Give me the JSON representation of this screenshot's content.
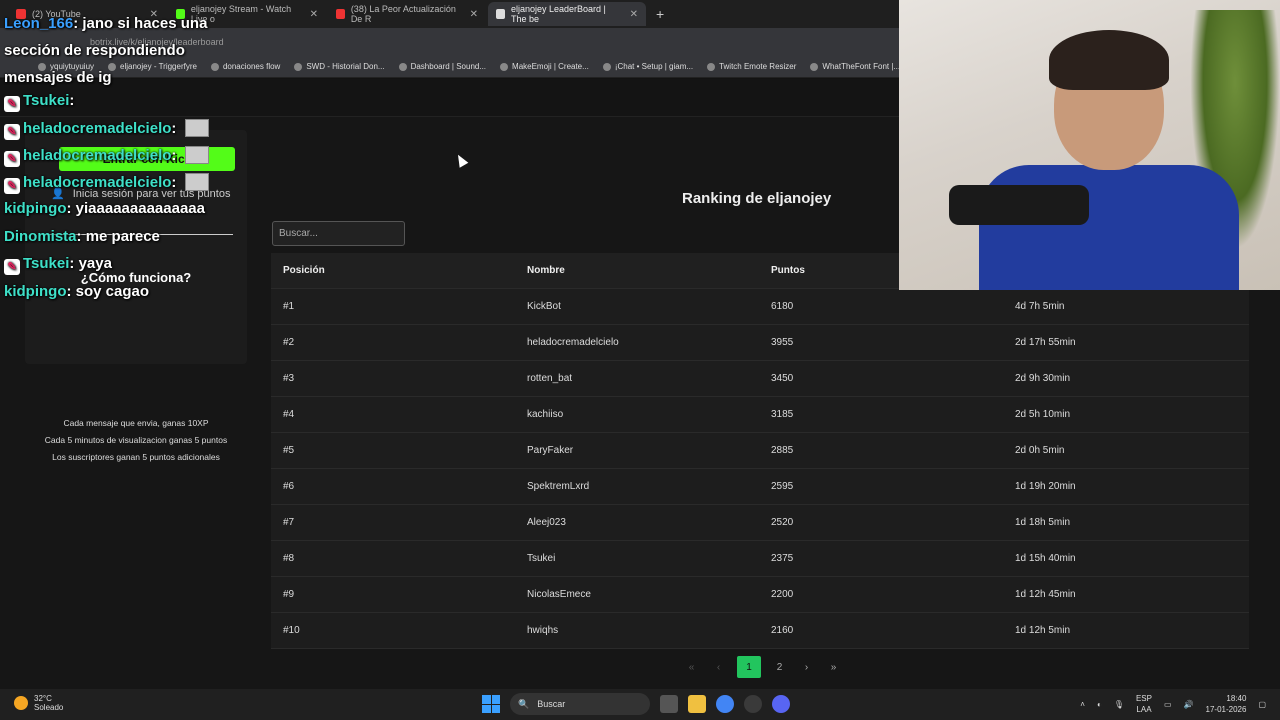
{
  "browser": {
    "tabs": [
      {
        "title": "(2) YouTube"
      },
      {
        "title": "eljanojey Stream - Watch Live o"
      },
      {
        "title": "(38) La Peor Actualización De R"
      },
      {
        "title": "eljanojey LeaderBoard | The be"
      }
    ],
    "address": "botrix.live/k/eljanojey/leaderboard",
    "bookmarks": [
      "yquiytuyuiuy",
      "eljanojey - Triggerfyre",
      "donaciones flow",
      "SWD - Historial Don...",
      "Dashboard | Sound...",
      "MakeEmoji | Create...",
      "¡Chat • Setup | giam...",
      "Twitch Emote Resizer",
      "WhatTheFont Font |..."
    ]
  },
  "sidebar": {
    "kick_button": "Entrar con Kick",
    "login_hint": "Inicia sesión para ver tus puntos",
    "how_title": "¿Cómo funciona?",
    "how_lines": [
      "Cada mensaje que envia, ganas 10XP",
      "Cada 5 minutos de visualizacion ganas 5 puntos",
      "Los suscriptores ganan 5 puntos adicionales"
    ]
  },
  "ranking": {
    "title": "Ranking de eljanojey",
    "search_placeholder": "Buscar...",
    "headers": {
      "position": "Posición",
      "name": "Nombre",
      "points": "Puntos"
    },
    "rows": [
      {
        "pos": "#1",
        "name": "KickBot",
        "points": "6180",
        "time": "4d 7h 5min"
      },
      {
        "pos": "#2",
        "name": "heladocremadelcielo",
        "points": "3955",
        "time": "2d 17h 55min"
      },
      {
        "pos": "#3",
        "name": "rotten_bat",
        "points": "3450",
        "time": "2d 9h 30min"
      },
      {
        "pos": "#4",
        "name": "kachiiso",
        "points": "3185",
        "time": "2d 5h 10min"
      },
      {
        "pos": "#5",
        "name": "ParyFaker",
        "points": "2885",
        "time": "2d 0h 5min"
      },
      {
        "pos": "#6",
        "name": "SpektremLxrd",
        "points": "2595",
        "time": "1d 19h 20min"
      },
      {
        "pos": "#7",
        "name": "Aleej023",
        "points": "2520",
        "time": "1d 18h 5min"
      },
      {
        "pos": "#8",
        "name": "Tsukei",
        "points": "2375",
        "time": "1d 15h 40min"
      },
      {
        "pos": "#9",
        "name": "NicolasEmece",
        "points": "2200",
        "time": "1d 12h 45min"
      },
      {
        "pos": "#10",
        "name": "hwiqhs",
        "points": "2160",
        "time": "1d 12h 5min"
      }
    ],
    "pages": [
      "1",
      "2"
    ],
    "current_page": "1"
  },
  "chat": [
    {
      "user": "Leon_166",
      "text": "jano si haces una sección de respondiendo mensajes de ig"
    },
    {
      "user": "Tsukei",
      "text": ""
    },
    {
      "user": "heladocremadelcielo",
      "text": ""
    },
    {
      "user": "heladocremadelcielo",
      "text": ""
    },
    {
      "user": "heladocremadelcielo",
      "text": ""
    },
    {
      "user": "kidpingo",
      "text": "yiaaaaaaaaaaaaaa"
    },
    {
      "user": "Dinomista",
      "text": "me parece"
    },
    {
      "user": "Tsukei",
      "text": "yaya"
    },
    {
      "user": "kidpingo",
      "text": "soy cagao"
    }
  ],
  "taskbar": {
    "temp": "32°C",
    "weather": "Soleado",
    "search": "Buscar",
    "lang": "ESP",
    "lang_sub": "LAA",
    "time": "18:40",
    "date": "17-01-2026"
  },
  "colors": {
    "kick_green": "#53fc18",
    "page_active": "#22c55e",
    "chat_user": "#3ee0c8"
  }
}
